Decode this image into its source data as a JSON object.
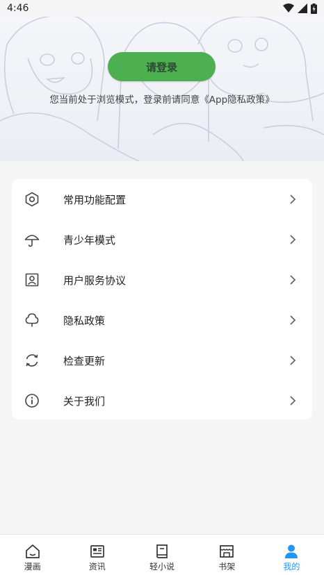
{
  "status_bar": {
    "time": "4:46"
  },
  "header": {
    "login_label": "请登录",
    "notice": "您当前处于浏览模式，登录前请同意《App隐私政策》"
  },
  "menu": {
    "items": [
      {
        "label": "常用功能配置",
        "icon": "settings-hexagon-icon"
      },
      {
        "label": "青少年模式",
        "icon": "umbrella-icon"
      },
      {
        "label": "用户服务协议",
        "icon": "user-portrait-icon"
      },
      {
        "label": "隐私政策",
        "icon": "tree-icon"
      },
      {
        "label": "检查更新",
        "icon": "refresh-icon"
      },
      {
        "label": "关于我们",
        "icon": "info-icon"
      }
    ]
  },
  "tabbar": {
    "tabs": [
      {
        "label": "漫画",
        "icon": "home-icon"
      },
      {
        "label": "资讯",
        "icon": "news-icon"
      },
      {
        "label": "轻小说",
        "icon": "book-icon"
      },
      {
        "label": "书架",
        "icon": "bookshelf-icon"
      },
      {
        "label": "我的",
        "icon": "person-icon"
      }
    ],
    "active_index": 4
  },
  "colors": {
    "accent": "#2196f3",
    "login_button": "#4caf50",
    "background": "#f5f5f5"
  }
}
